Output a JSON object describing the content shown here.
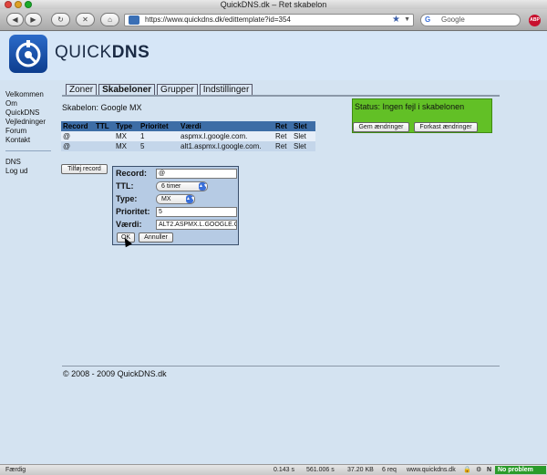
{
  "window": {
    "title": "QuickDNS.dk – Ret skabelon"
  },
  "browser": {
    "url": "https://www.quickdns.dk/edittemplate?id=354",
    "search_placeholder": "Google",
    "abp_label": "ABP"
  },
  "site": {
    "logo_text_light": "QUICK",
    "logo_text_bold": "DNS"
  },
  "sidebar": {
    "items": [
      "Velkommen",
      "Om QuickDNS",
      "Vejledninger",
      "Forum",
      "Kontakt"
    ],
    "items2": [
      "DNS",
      "Log ud"
    ]
  },
  "tabs": [
    "Zoner",
    "Skabeloner",
    "Grupper",
    "Indstillinger"
  ],
  "subtitle": "Skabelon: Google MX",
  "records": {
    "headers": [
      "Record",
      "TTL",
      "Type",
      "Prioritet",
      "Værdi",
      "Ret",
      "Slet"
    ],
    "rows": [
      [
        "@",
        "",
        "MX",
        "1",
        "aspmx.l.google.com.",
        "Ret",
        "Slet"
      ],
      [
        "@",
        "",
        "MX",
        "5",
        "alt1.aspmx.l.google.com.",
        "Ret",
        "Slet"
      ]
    ]
  },
  "add_record_label": "Tilføj record",
  "status": {
    "text": "Status: Ingen fejl i skabelonen",
    "save_label": "Gem ændringer",
    "discard_label": "Forkast ændringer"
  },
  "form": {
    "record_label": "Record:",
    "record_value": "@",
    "ttl_label": "TTL:",
    "ttl_value": "6 timer",
    "type_label": "Type:",
    "type_value": "MX",
    "priority_label": "Prioritet:",
    "priority_value": "5",
    "value_label": "Værdi:",
    "value_value": "ALT2.ASPMX.L.GOOGLE.COM",
    "ok_label": "OK",
    "cancel_label": "Annuller"
  },
  "footer": "© 2008 - 2009 QuickDNS.dk",
  "statusbar": {
    "left": "Færdig",
    "time1": "0.143 s",
    "time2": "561.006 s",
    "size": "37.20 KB",
    "req": "6 req",
    "host": "www.quickdns.dk",
    "badge": "No problem"
  },
  "colors": {
    "accent": "#3d6da6",
    "status_ok": "#62c026",
    "page_bg": "#d4e3f1"
  }
}
